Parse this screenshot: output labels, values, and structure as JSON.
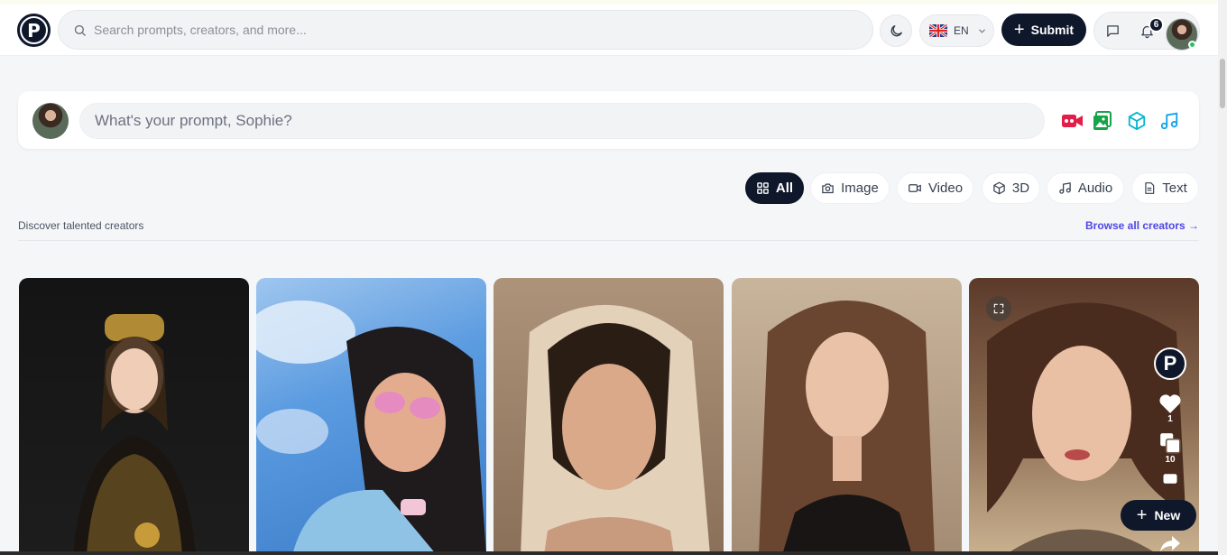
{
  "header": {
    "search_placeholder": "Search prompts, creators, and more...",
    "language_code": "EN",
    "submit_label": "Submit",
    "notification_count": "6"
  },
  "prompt": {
    "placeholder": "What's your prompt, Sophie?"
  },
  "filters": [
    {
      "label": "All",
      "icon": "grid-icon",
      "active": true
    },
    {
      "label": "Image",
      "icon": "camera-icon",
      "active": false
    },
    {
      "label": "Video",
      "icon": "video-icon",
      "active": false
    },
    {
      "label": "3D",
      "icon": "cube-icon",
      "active": false
    },
    {
      "label": "Audio",
      "icon": "music-icon",
      "active": false
    },
    {
      "label": "Text",
      "icon": "document-icon",
      "active": false
    }
  ],
  "section": {
    "title": "Discover talented creators",
    "browse_link": "Browse all creators →"
  },
  "card_actions": {
    "like_count": "1",
    "remix_count": "10",
    "new_label": "New"
  },
  "colors": {
    "primary": "#0f172a",
    "link": "#4f46e5",
    "video_icon": "#e11d48",
    "image_icon": "#16a34a",
    "cube_icon": "#06b6d4",
    "music_icon": "#0ea5e9"
  }
}
